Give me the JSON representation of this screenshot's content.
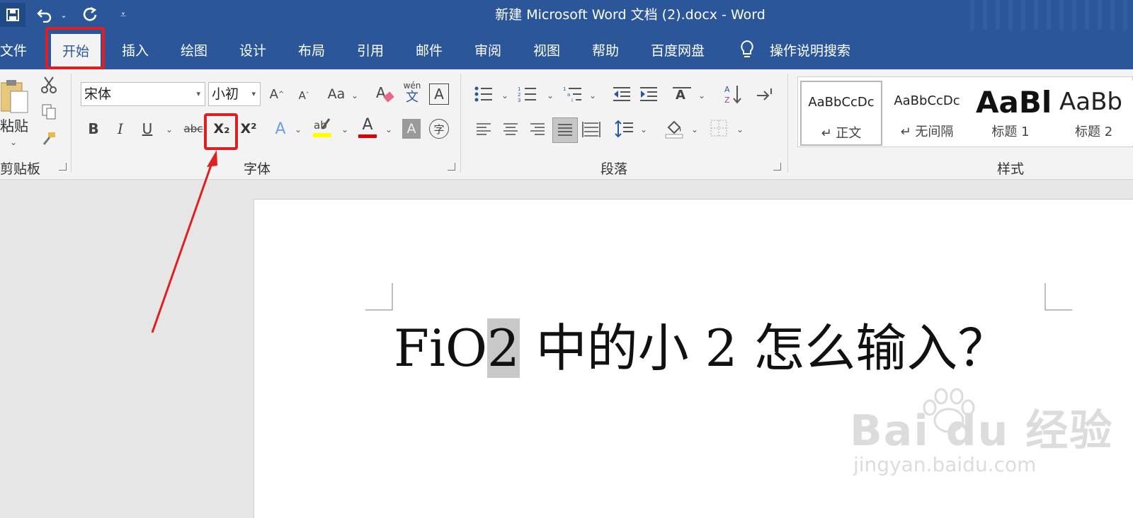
{
  "window": {
    "title": "新建 Microsoft Word 文档 (2).docx  -  Word"
  },
  "quick_access": {
    "save_icon": "save-icon",
    "undo_icon": "undo-icon",
    "redo_icon": "redo-icon",
    "customize_icon": "customize-icon"
  },
  "tabs": [
    {
      "label": "文件"
    },
    {
      "label": "开始"
    },
    {
      "label": "插入"
    },
    {
      "label": "绘图"
    },
    {
      "label": "设计"
    },
    {
      "label": "布局"
    },
    {
      "label": "引用"
    },
    {
      "label": "邮件"
    },
    {
      "label": "审阅"
    },
    {
      "label": "视图"
    },
    {
      "label": "帮助"
    },
    {
      "label": "百度网盘"
    }
  ],
  "tell_me": {
    "label": "操作说明搜索"
  },
  "clipboard": {
    "paste_label": "粘贴",
    "group_label": "剪贴板"
  },
  "font": {
    "name": "宋体",
    "size": "小初",
    "group_label": "字体",
    "bold": "B",
    "italic": "I",
    "underline": "U",
    "strike": "abc",
    "subscript": "X₂",
    "superscript": "X²",
    "change_case": "Aa",
    "phonetic_top": "wén",
    "phonetic_bottom": "文",
    "border_char": "A",
    "font_color": "A",
    "shading_char": "A",
    "enclose_char": "字",
    "grow": "A",
    "shrink": "A",
    "effects": "A"
  },
  "paragraph": {
    "group_label": "段落"
  },
  "styles": {
    "group_label": "样式",
    "items": [
      {
        "preview": "AaBbCcDc",
        "name": "↵ 正文"
      },
      {
        "preview": "AaBbCcDc",
        "name": "↵ 无间隔"
      },
      {
        "preview": "AaBl",
        "name": "标题 1"
      },
      {
        "preview": "AaBb",
        "name": "标题 2"
      }
    ]
  },
  "document": {
    "text_before": "FiO",
    "selected": "2",
    "text_after": " 中的小 2 怎么输入？"
  },
  "watermark": {
    "brand": "Bai du 经验",
    "url": "jingyan.baidu.com"
  },
  "colors": {
    "ribbon_blue": "#2b579a",
    "highlight": "#ffff00",
    "font_color": "#e00000",
    "annotation": "#e02020"
  }
}
